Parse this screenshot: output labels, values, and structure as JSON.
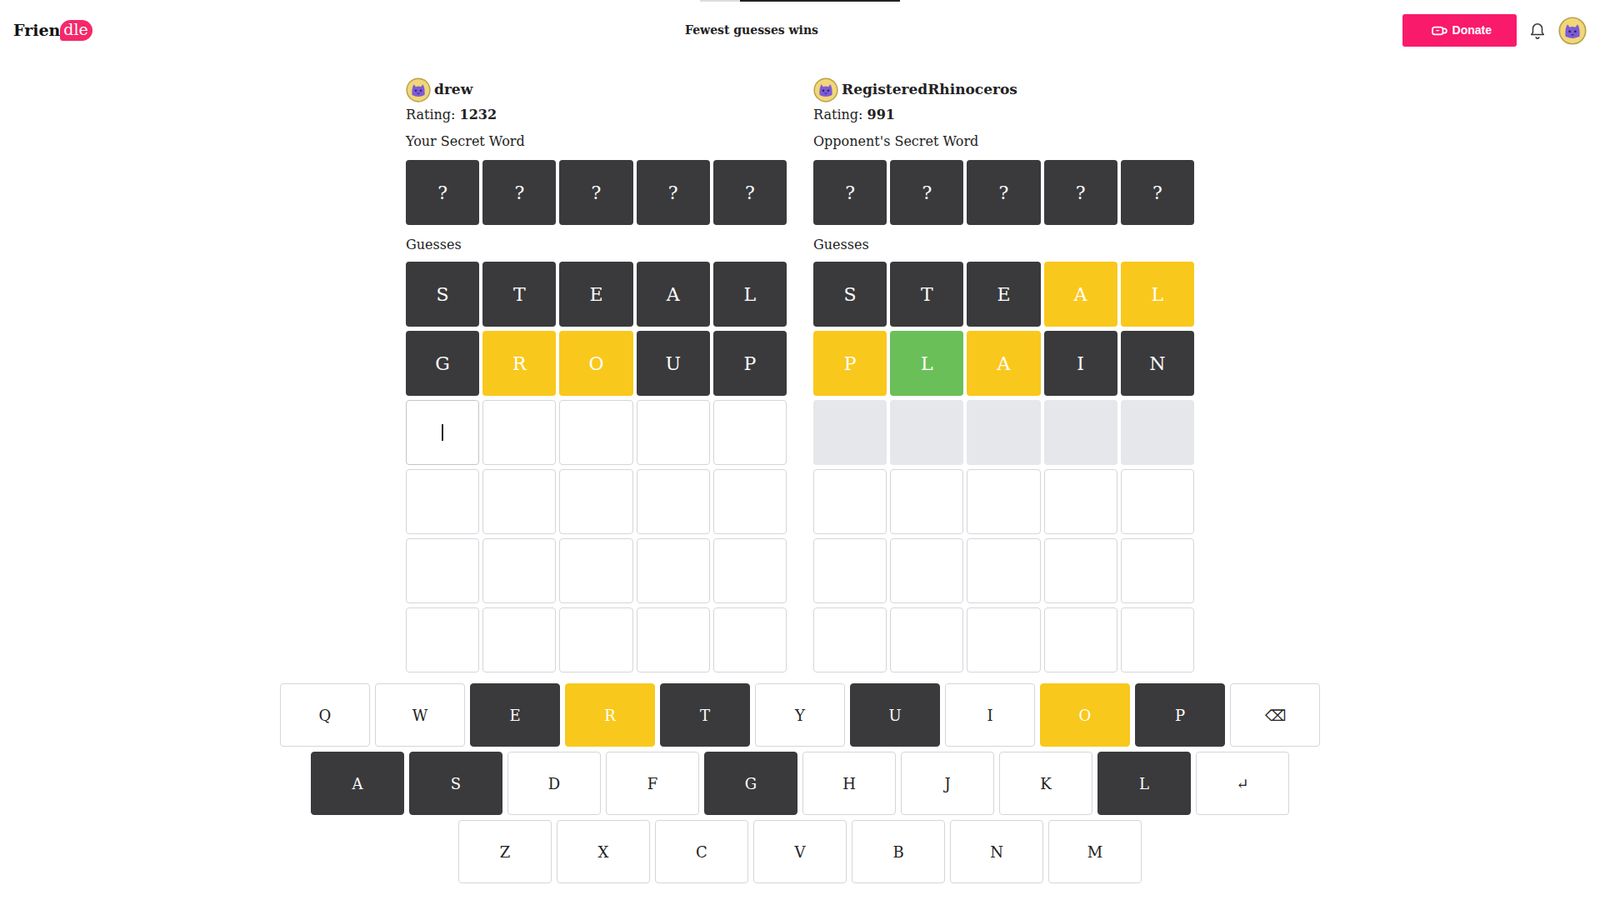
{
  "timer": {
    "level": 0.8
  },
  "header": {
    "logo": {
      "text": "Frien",
      "badge": "dle"
    },
    "tagline": "Fewest guesses wins",
    "donate": "Donate"
  },
  "boards": [
    {
      "player": "drew",
      "rating_label": "Rating:",
      "rating": "1232",
      "secret_label": "Your Secret Word",
      "secret": [
        "?",
        "?",
        "?",
        "?",
        "?"
      ],
      "guesses_label": "Guesses",
      "rows": [
        {
          "cells": [
            {
              "letter": "S",
              "state": "absent"
            },
            {
              "letter": "T",
              "state": "absent"
            },
            {
              "letter": "E",
              "state": "absent"
            },
            {
              "letter": "A",
              "state": "absent"
            },
            {
              "letter": "L",
              "state": "absent"
            }
          ]
        },
        {
          "cells": [
            {
              "letter": "G",
              "state": "absent"
            },
            {
              "letter": "R",
              "state": "present"
            },
            {
              "letter": "O",
              "state": "present"
            },
            {
              "letter": "U",
              "state": "absent"
            },
            {
              "letter": "P",
              "state": "absent"
            }
          ]
        },
        {
          "cells": [
            {
              "letter": "",
              "state": "cursor"
            },
            {
              "letter": "",
              "state": "blank"
            },
            {
              "letter": "",
              "state": "blank"
            },
            {
              "letter": "",
              "state": "blank"
            },
            {
              "letter": "",
              "state": "blank"
            }
          ]
        },
        {
          "cells": [
            {
              "letter": "",
              "state": "blank"
            },
            {
              "letter": "",
              "state": "blank"
            },
            {
              "letter": "",
              "state": "blank"
            },
            {
              "letter": "",
              "state": "blank"
            },
            {
              "letter": "",
              "state": "blank"
            }
          ]
        },
        {
          "cells": [
            {
              "letter": "",
              "state": "blank"
            },
            {
              "letter": "",
              "state": "blank"
            },
            {
              "letter": "",
              "state": "blank"
            },
            {
              "letter": "",
              "state": "blank"
            },
            {
              "letter": "",
              "state": "blank"
            }
          ]
        },
        {
          "cells": [
            {
              "letter": "",
              "state": "blank"
            },
            {
              "letter": "",
              "state": "blank"
            },
            {
              "letter": "",
              "state": "blank"
            },
            {
              "letter": "",
              "state": "blank"
            },
            {
              "letter": "",
              "state": "blank"
            }
          ]
        }
      ]
    },
    {
      "player": "RegisteredRhinoceros",
      "rating_label": "Rating:",
      "rating": "991",
      "secret_label": "Opponent's Secret Word",
      "secret": [
        "?",
        "?",
        "?",
        "?",
        "?"
      ],
      "guesses_label": "Guesses",
      "rows": [
        {
          "cells": [
            {
              "letter": "S",
              "state": "absent"
            },
            {
              "letter": "T",
              "state": "absent"
            },
            {
              "letter": "E",
              "state": "absent"
            },
            {
              "letter": "A",
              "state": "present"
            },
            {
              "letter": "L",
              "state": "present"
            }
          ]
        },
        {
          "cells": [
            {
              "letter": "P",
              "state": "present"
            },
            {
              "letter": "L",
              "state": "correct"
            },
            {
              "letter": "A",
              "state": "present"
            },
            {
              "letter": "I",
              "state": "absent"
            },
            {
              "letter": "N",
              "state": "absent"
            }
          ]
        },
        {
          "cells": [
            {
              "letter": "",
              "state": "waiting"
            },
            {
              "letter": "",
              "state": "waiting"
            },
            {
              "letter": "",
              "state": "waiting"
            },
            {
              "letter": "",
              "state": "waiting"
            },
            {
              "letter": "",
              "state": "waiting"
            }
          ]
        },
        {
          "cells": [
            {
              "letter": "",
              "state": "blank"
            },
            {
              "letter": "",
              "state": "blank"
            },
            {
              "letter": "",
              "state": "blank"
            },
            {
              "letter": "",
              "state": "blank"
            },
            {
              "letter": "",
              "state": "blank"
            }
          ]
        },
        {
          "cells": [
            {
              "letter": "",
              "state": "blank"
            },
            {
              "letter": "",
              "state": "blank"
            },
            {
              "letter": "",
              "state": "blank"
            },
            {
              "letter": "",
              "state": "blank"
            },
            {
              "letter": "",
              "state": "blank"
            }
          ]
        },
        {
          "cells": [
            {
              "letter": "",
              "state": "blank"
            },
            {
              "letter": "",
              "state": "blank"
            },
            {
              "letter": "",
              "state": "blank"
            },
            {
              "letter": "",
              "state": "blank"
            },
            {
              "letter": "",
              "state": "blank"
            }
          ]
        }
      ]
    }
  ],
  "keyboard": {
    "rows": [
      [
        {
          "label": "Q",
          "state": "unused"
        },
        {
          "label": "W",
          "state": "unused"
        },
        {
          "label": "E",
          "state": "absent"
        },
        {
          "label": "R",
          "state": "present"
        },
        {
          "label": "T",
          "state": "absent"
        },
        {
          "label": "Y",
          "state": "unused"
        },
        {
          "label": "U",
          "state": "absent"
        },
        {
          "label": "I",
          "state": "unused"
        },
        {
          "label": "O",
          "state": "present"
        },
        {
          "label": "P",
          "state": "absent"
        },
        {
          "label": "⌫",
          "state": "unused"
        }
      ],
      [
        {
          "label": "A",
          "state": "absent"
        },
        {
          "label": "S",
          "state": "absent"
        },
        {
          "label": "D",
          "state": "unused"
        },
        {
          "label": "F",
          "state": "unused"
        },
        {
          "label": "G",
          "state": "absent"
        },
        {
          "label": "H",
          "state": "unused"
        },
        {
          "label": "J",
          "state": "unused"
        },
        {
          "label": "K",
          "state": "unused"
        },
        {
          "label": "L",
          "state": "absent"
        },
        {
          "label": "↵",
          "state": "unused"
        }
      ],
      [
        {
          "label": "Z",
          "state": "unused"
        },
        {
          "label": "X",
          "state": "unused"
        },
        {
          "label": "C",
          "state": "unused"
        },
        {
          "label": "V",
          "state": "unused"
        },
        {
          "label": "B",
          "state": "unused"
        },
        {
          "label": "N",
          "state": "unused"
        },
        {
          "label": "M",
          "state": "unused"
        }
      ]
    ]
  }
}
